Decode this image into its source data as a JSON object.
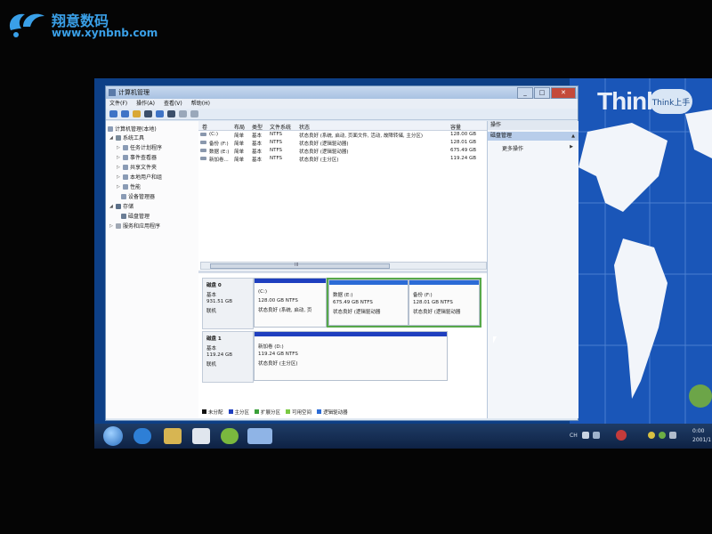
{
  "watermark": {
    "brand": "翔意数码",
    "url": "www.xynbnb.com"
  },
  "desktop": {
    "brand_text": "Think",
    "gadget_label": "Think上手"
  },
  "window": {
    "title": "计算机管理",
    "controls": {
      "minimize": "_",
      "maximize": "□",
      "close": "✕"
    },
    "menu": [
      "文件(F)",
      "操作(A)",
      "查看(V)",
      "帮助(H)"
    ]
  },
  "tree": {
    "root": "计算机管理(本地)",
    "system_tools": "系统工具",
    "task_scheduler": "任务计划程序",
    "event_viewer": "事件查看器",
    "shared_folders": "共享文件夹",
    "local_users": "本地用户和组",
    "performance": "性能",
    "device_manager": "设备管理器",
    "storage": "存储",
    "disk_management": "磁盘管理",
    "services": "服务和应用程序"
  },
  "volumes": {
    "headers": {
      "volume": "卷",
      "layout": "布局",
      "type": "类型",
      "fs": "文件系统",
      "status": "状态",
      "capacity": "容量"
    },
    "rows": [
      {
        "volume": "(C:)",
        "layout": "简单",
        "type": "基本",
        "fs": "NTFS",
        "status": "状态良好 (系统, 启动, 页面文件, 活动, 故障转储, 主分区)",
        "capacity": "128.00 GB"
      },
      {
        "volume": "备份 (F:)",
        "layout": "简单",
        "type": "基本",
        "fs": "NTFS",
        "status": "状态良好 (逻辑驱动器)",
        "capacity": "128.01 GB"
      },
      {
        "volume": "数据 (E:)",
        "layout": "简单",
        "type": "基本",
        "fs": "NTFS",
        "status": "状态良好 (逻辑驱动器)",
        "capacity": "675.49 GB"
      },
      {
        "volume": "新加卷...",
        "layout": "简单",
        "type": "基本",
        "fs": "NTFS",
        "status": "状态良好 (主分区)",
        "capacity": "119.24 GB"
      }
    ],
    "scroll_mark": "III"
  },
  "disks": [
    {
      "name": "磁盘 0",
      "type": "基本",
      "size": "931.51 GB",
      "state": "联机",
      "partitions": [
        {
          "name": "(C:)",
          "size": "128.00 GB NTFS",
          "status": "状态良好 (系统, 启动, 页"
        },
        {
          "name": "数据 (E:)",
          "size": "675.49 GB NTFS",
          "status": "状态良好 (逻辑驱动器"
        },
        {
          "name": "备份 (F:)",
          "size": "128.01 GB NTFS",
          "status": "状态良好 (逻辑驱动器"
        }
      ]
    },
    {
      "name": "磁盘 1",
      "type": "基本",
      "size": "119.24 GB",
      "state": "联机",
      "partitions": [
        {
          "name": "新加卷 (D:)",
          "size": "119.24 GB NTFS",
          "status": "状态良好 (主分区)"
        }
      ]
    }
  ],
  "legend": [
    {
      "label": "未分配",
      "color": "#111111"
    },
    {
      "label": "主分区",
      "color": "#1f3fbf"
    },
    {
      "label": "扩展分区",
      "color": "#3aa03a"
    },
    {
      "label": "可用空间",
      "color": "#7ac943"
    },
    {
      "label": "逻辑驱动器",
      "color": "#2b6bd6"
    }
  ],
  "actions": {
    "header": "操作",
    "selected": "磁盘管理",
    "more": "更多操作"
  },
  "taskbar": {
    "lang": "CH",
    "clock_time": "0:00",
    "clock_date": "2001/1"
  },
  "colors": {
    "primary_bar": "#1f3fbf",
    "extended_border": "#57a84a",
    "logical_bar": "#2b6bd6"
  }
}
